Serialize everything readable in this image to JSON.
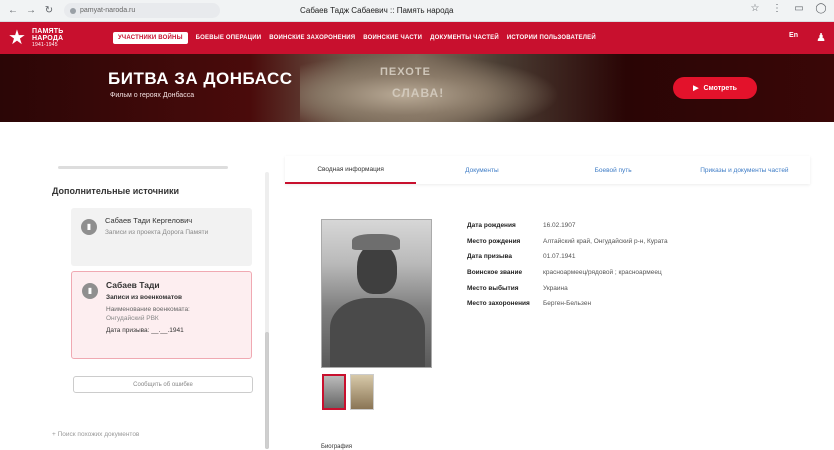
{
  "browser": {
    "url": "pamyat-naroda.ru",
    "tab_title": "Сабаев Тадж Сабаевич :: Память народа"
  },
  "site": {
    "logo_line1": "ПАМЯТЬ",
    "logo_line2": "НАРОДА",
    "logo_years": "1941-1945",
    "menu": [
      "Участники войны",
      "Боевые операции",
      "Воинские захоронения",
      "Воинские части",
      "Документы частей",
      "Истории пользователей"
    ],
    "lang": "En"
  },
  "banner": {
    "title": "БИТВА ЗА ДОНБАСС",
    "subtitle": "Фильм о героях Донбасса",
    "monument_text1": "ПЕХОТЕ",
    "monument_text2": "СЛАВА!",
    "watch_label": "Смотреть"
  },
  "sidebar": {
    "heading": "Дополнительные источники",
    "card1": {
      "name": "Сабаев Тади Кергелович",
      "sub": "Записи из проекта Дорога Памяти"
    },
    "card2": {
      "name": "Сабаев Тади",
      "sub": "Записи из военкоматов",
      "label": "Наименование военкомата:",
      "value": "Онгудайский РВК",
      "date": "Дата призыва: __.__.1941"
    },
    "report_label": "Сообщить об ошибке",
    "search_link": "Поиск похожих документов"
  },
  "tabs": [
    "Сводная информация",
    "Документы",
    "Боевой путь",
    "Приказы и документы частей"
  ],
  "facts": [
    {
      "k": "Дата рождения",
      "v": "16.02.1907"
    },
    {
      "k": "Место рождения",
      "v": "Алтайский край, Онгудайский р-н, Курата"
    },
    {
      "k": "Дата призыва",
      "v": "01.07.1941"
    },
    {
      "k": "Воинское звание",
      "v": "красноармеец/рядовой ; красноармеец"
    },
    {
      "k": "Место выбытия",
      "v": "Украина"
    },
    {
      "k": "Место захоронения",
      "v": "Берген-Бельзен"
    }
  ],
  "bio_label": "Биография",
  "colors": {
    "brand_red": "#c8102e",
    "link_blue": "#3e7cc6"
  }
}
